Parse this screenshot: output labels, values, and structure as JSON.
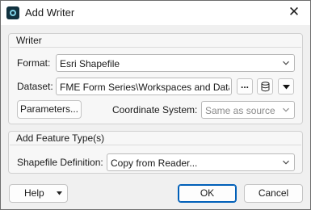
{
  "window": {
    "title": "Add Writer",
    "close_glyph": "✕",
    "app_icon": "fme-app-icon"
  },
  "writer": {
    "group_title": "Writer",
    "format_label": "Format:",
    "format_value": "Esri Shapefile",
    "dataset_label": "Dataset:",
    "dataset_value": "FME Form Series\\Workspaces and Data\"",
    "browse_button_label": "...",
    "dataset_icon": "database-stack-icon",
    "dataset_menu_icon": "triangle-down-icon",
    "parameters_button_label": "Parameters...",
    "coord_sys_label": "Coordinate System:",
    "coord_sys_value": "Same as source",
    "coord_sys_enabled": false
  },
  "feature_types": {
    "group_title": "Add Feature Type(s)",
    "shapefile_def_label": "Shapefile Definition:",
    "shapefile_def_value": "Copy from Reader..."
  },
  "footer": {
    "help_label": "Help",
    "ok_label": "OK",
    "cancel_label": "Cancel"
  },
  "colors": {
    "accent": "#005fb8",
    "dialog_bg": "#f0f0f0",
    "group_bg": "#f7f7f7"
  }
}
